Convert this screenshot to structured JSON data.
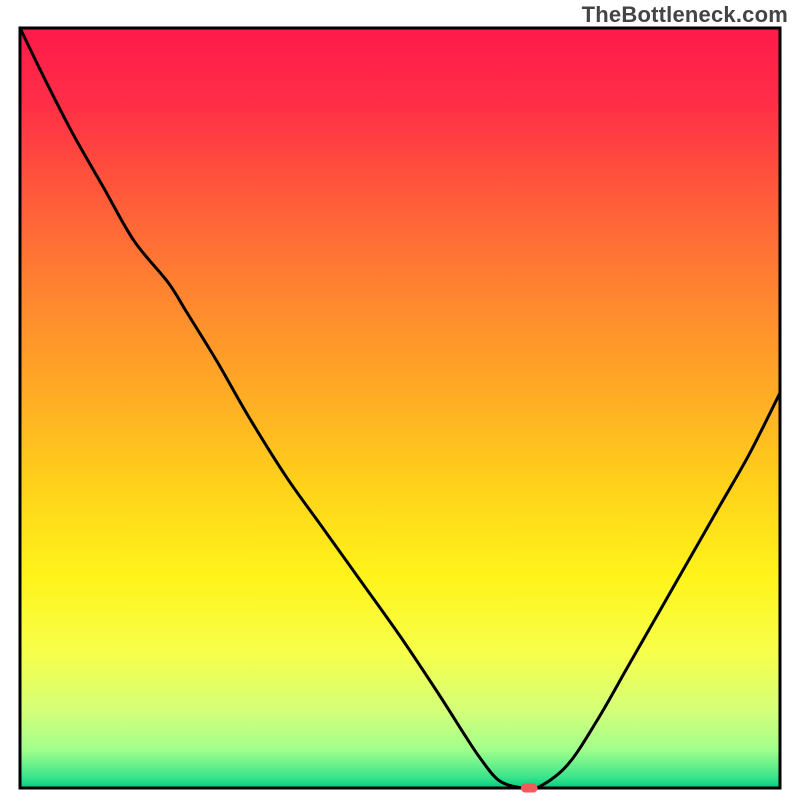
{
  "watermark": "TheBottleneck.com",
  "chart_data": {
    "type": "line",
    "title": "",
    "xlabel": "",
    "ylabel": "",
    "xlim": [
      0,
      100
    ],
    "ylim": [
      0,
      100
    ],
    "legend": false,
    "grid": false,
    "background_gradient_stops": [
      {
        "offset": 0.0,
        "color": "#ff1a4a"
      },
      {
        "offset": 0.1,
        "color": "#ff2e47"
      },
      {
        "offset": 0.22,
        "color": "#ff5a3a"
      },
      {
        "offset": 0.35,
        "color": "#ff8530"
      },
      {
        "offset": 0.48,
        "color": "#ffab25"
      },
      {
        "offset": 0.6,
        "color": "#ffd11a"
      },
      {
        "offset": 0.72,
        "color": "#fff31a"
      },
      {
        "offset": 0.82,
        "color": "#f7ff4a"
      },
      {
        "offset": 0.9,
        "color": "#d3ff7a"
      },
      {
        "offset": 0.95,
        "color": "#a0ff8c"
      },
      {
        "offset": 0.985,
        "color": "#3de58a"
      },
      {
        "offset": 1.0,
        "color": "#00d084"
      }
    ],
    "series": [
      {
        "name": "bottleneck-curve",
        "x": [
          0.0,
          3.4,
          7.0,
          11.0,
          15.0,
          19.5,
          22.0,
          26.0,
          30.0,
          35.0,
          40.0,
          45.0,
          50.0,
          55.0,
          58.5,
          60.5,
          63.0,
          66.0,
          68.0,
          72.0,
          76.0,
          80.0,
          84.0,
          88.0,
          92.0,
          96.0,
          100.0
        ],
        "y": [
          100.0,
          93.0,
          86.0,
          79.0,
          72.0,
          66.5,
          62.5,
          56.0,
          49.0,
          41.0,
          34.0,
          27.0,
          20.0,
          12.5,
          7.0,
          4.0,
          1.0,
          0.0,
          0.0,
          3.0,
          9.0,
          16.0,
          23.0,
          30.0,
          37.0,
          44.0,
          52.0
        ]
      }
    ],
    "annotations": [
      {
        "name": "optimal-marker",
        "type": "rounded-rect",
        "x": 67.0,
        "y": 0.0,
        "width_x": 2.2,
        "height_y": 1.2,
        "color": "#f15a5a"
      }
    ]
  }
}
